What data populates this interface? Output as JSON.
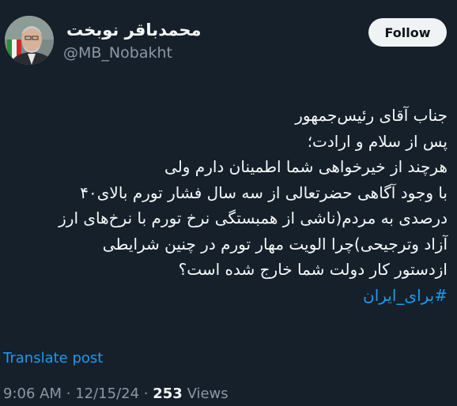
{
  "author": {
    "display_name": "محمدباقر نوبخت",
    "handle": "@MB_Nobakht"
  },
  "follow_button_label": "Follow",
  "tweet": {
    "lines": [
      "جناب آقای رئیس‌جمهور",
      "پس از سلام و ارادت؛",
      "هرچند از خیرخواهی شما اطمینان دارم ولی",
      "با وجود آگاهی حضرتعالی از سه سال فشار تورم بالای۴۰",
      "درصدی به مردم(ناشی از همبستگی نرخ تورم با نرخ‌های ارز",
      "آزاد وترجیحی)چرا الویت مهار تورم در چنین شرایطی",
      "ازدستور کار دولت شما خارج شده است؟"
    ],
    "hashtag": "#برای_ایران"
  },
  "translate_label": "Translate post",
  "meta": {
    "time": "9:06 AM",
    "separator": "·",
    "date": "12/15/24",
    "views_count": "253",
    "views_label": "Views"
  },
  "colors": {
    "background": "#15202b",
    "accent": "#1d9bf0",
    "secondary_text": "#8b98a5"
  }
}
